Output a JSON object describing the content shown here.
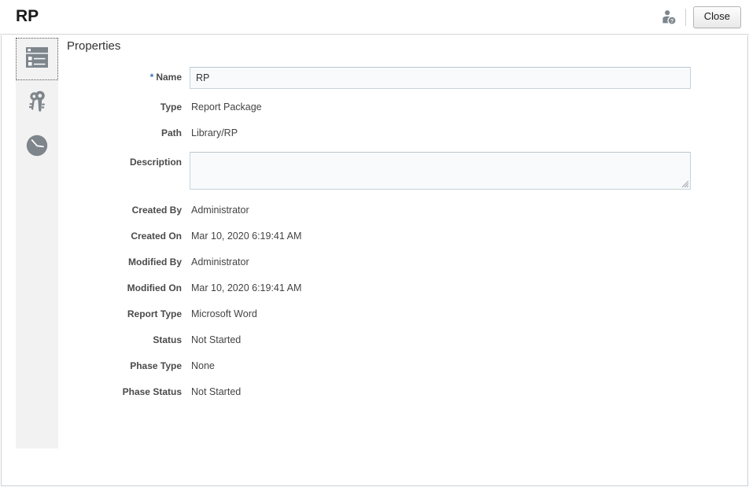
{
  "header": {
    "title": "RP",
    "help_user_icon": "user-help-icon",
    "close_label": "Close"
  },
  "sidebar": {
    "items": [
      {
        "name": "properties",
        "icon": "properties-list-icon",
        "selected": true
      },
      {
        "name": "access",
        "icon": "keys-icon",
        "selected": false
      },
      {
        "name": "history",
        "icon": "clock-icon",
        "selected": false
      }
    ]
  },
  "main": {
    "section_title": "Properties",
    "fields": [
      {
        "label": "Name",
        "value": "RP",
        "type": "input",
        "required": true
      },
      {
        "label": "Type",
        "value": "Report Package",
        "type": "text",
        "required": false
      },
      {
        "label": "Path",
        "value": "Library/RP",
        "type": "text",
        "required": false
      },
      {
        "label": "Description",
        "value": "",
        "type": "textarea",
        "required": false
      },
      {
        "label": "Created By",
        "value": "Administrator",
        "type": "text",
        "required": false
      },
      {
        "label": "Created On",
        "value": "Mar 10, 2020 6:19:41 AM",
        "type": "text",
        "required": false
      },
      {
        "label": "Modified By",
        "value": "Administrator",
        "type": "text",
        "required": false
      },
      {
        "label": "Modified On",
        "value": "Mar 10, 2020 6:19:41 AM",
        "type": "text",
        "required": false
      },
      {
        "label": "Report Type",
        "value": "Microsoft Word",
        "type": "text",
        "required": false
      },
      {
        "label": "Status",
        "value": "Not Started",
        "type": "text",
        "required": false
      },
      {
        "label": "Phase Type",
        "value": "None",
        "type": "text",
        "required": false
      },
      {
        "label": "Phase Status",
        "value": "Not Started",
        "type": "text",
        "required": false
      }
    ],
    "name_placeholder": "",
    "description_placeholder": ""
  },
  "colors": {
    "required_star": "#3f74b5",
    "icon_grey": "#7e868c",
    "rail_bg": "#f2f2f2",
    "field_bg": "#f9fafc"
  }
}
